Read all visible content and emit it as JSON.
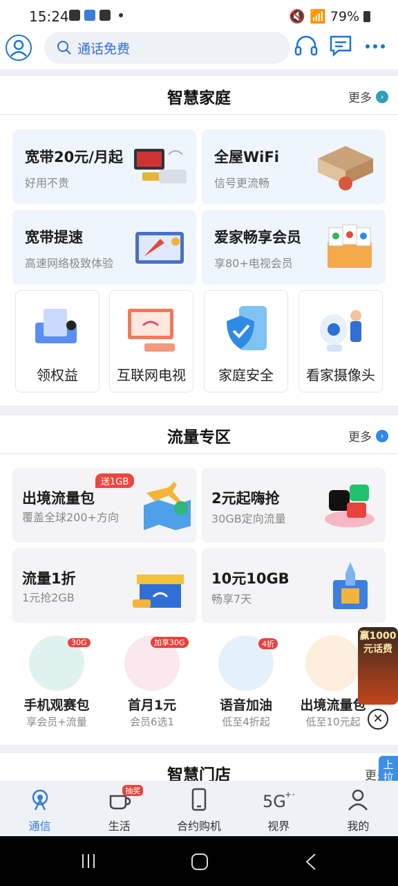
{
  "status": {
    "time": "15:24",
    "battery": "79%"
  },
  "search": {
    "placeholder": "通话免费"
  },
  "smart_home": {
    "title": "智慧家庭",
    "more": "更多",
    "cards": [
      {
        "title": "宽带20元/月起",
        "subtitle": "好用不贵"
      },
      {
        "title": "全屋WiFi",
        "subtitle": "信号更流畅"
      },
      {
        "title": "宽带提速",
        "subtitle": "高速网络极致体验"
      },
      {
        "title": "爱家畅享会员",
        "subtitle": "享80+电视会员"
      }
    ],
    "tiles": [
      {
        "label": "领权益"
      },
      {
        "label": "互联网电视"
      },
      {
        "label": "家庭安全"
      },
      {
        "label": "看家摄像头"
      }
    ]
  },
  "data_zone": {
    "title": "流量专区",
    "more": "更多",
    "cards": [
      {
        "title": "出境流量包",
        "subtitle": "覆盖全球200+方向",
        "badge": "送1GB"
      },
      {
        "title": "2元起嗨抢",
        "subtitle": "30GB定向流量"
      },
      {
        "title": "流量1折",
        "subtitle": "1元抢2GB"
      },
      {
        "title": "10元10GB",
        "subtitle": "畅享7天"
      }
    ],
    "items": [
      {
        "label": "手机观赛包",
        "subtitle": "享会员+流量",
        "badge": "30G"
      },
      {
        "label": "首月1元",
        "subtitle": "会员6选1",
        "badge": "加享30G"
      },
      {
        "label": "语音加油",
        "subtitle": "低至4折起",
        "badge": "4折"
      },
      {
        "label": "出境流量包",
        "subtitle": "低至10元起"
      }
    ]
  },
  "smart_store": {
    "title": "智慧门店",
    "more": "更多"
  },
  "float_ad": {
    "text": "赢1000元话费"
  },
  "pull_up": {
    "text": "上拉更多"
  },
  "tabs": [
    {
      "label": "通信",
      "active": true
    },
    {
      "label": "生活",
      "badge": "抽奖"
    },
    {
      "label": "合约购机"
    },
    {
      "label": "视界"
    },
    {
      "label": "我的"
    }
  ],
  "colors": {
    "accent": "#2f7bd9",
    "card_blue": "#eef5fc",
    "badge_red": "#e8423c"
  }
}
